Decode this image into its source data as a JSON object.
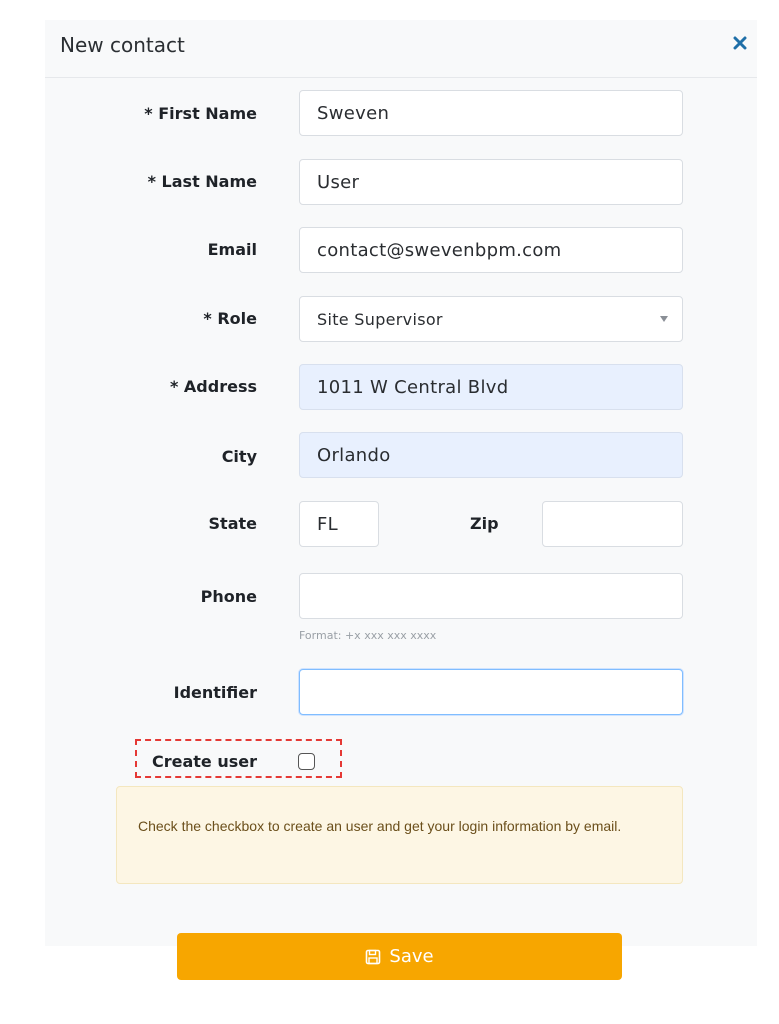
{
  "dialog": {
    "title": "New contact",
    "close_icon": "close-icon"
  },
  "form": {
    "first_name": {
      "label": "* First Name",
      "value": "Sweven"
    },
    "last_name": {
      "label": "* Last Name",
      "value": "User"
    },
    "email": {
      "label": "Email",
      "value": "contact@swevenbpm.com"
    },
    "role": {
      "label": "* Role",
      "value": "Site Supervisor"
    },
    "address": {
      "label": "* Address",
      "value": "1011 W Central Blvd"
    },
    "city": {
      "label": "City",
      "value": "Orlando"
    },
    "state": {
      "label": "State",
      "value": "FL"
    },
    "zip": {
      "label": "Zip",
      "value": ""
    },
    "phone": {
      "label": "Phone",
      "value": "",
      "hint": "Format: +x xxx xxx xxxx"
    },
    "identifier": {
      "label": "Identifier",
      "value": ""
    },
    "create_user": {
      "label": "Create user",
      "checked": false
    },
    "info": "Check the checkbox to create an user and get your login information by email."
  },
  "actions": {
    "save_label": "Save",
    "save_icon": "save-icon",
    "save_color": "#f7a600"
  },
  "colors": {
    "autofill_bg": "#e8f0fe",
    "alert_bg": "#fdf6e4",
    "highlight_border": "#e53935",
    "close_icon": "#1f6fa8"
  }
}
